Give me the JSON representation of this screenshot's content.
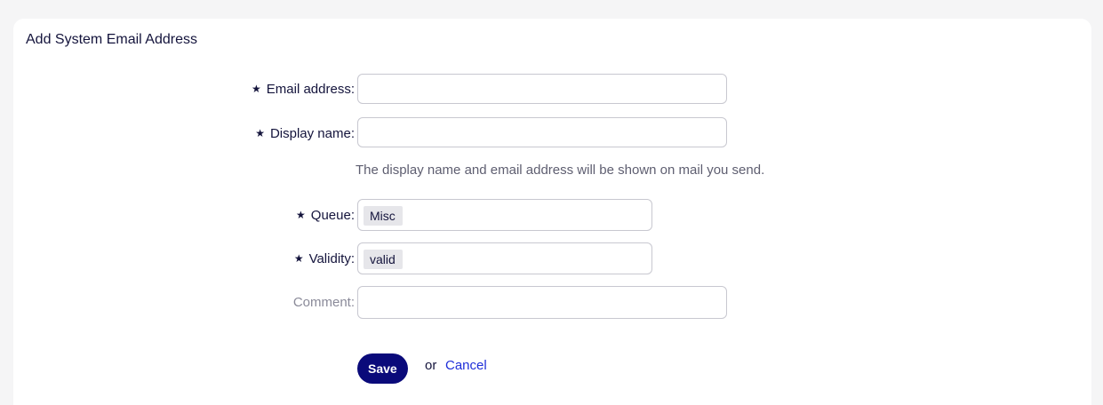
{
  "form": {
    "title": "Add System Email Address",
    "required_marker": "★",
    "email": {
      "label": "Email address:",
      "value": "",
      "placeholder": ""
    },
    "display_name": {
      "label": "Display name:",
      "value": "",
      "placeholder": ""
    },
    "hint": "The display name and email address will be shown on mail you send.",
    "queue": {
      "label": "Queue:",
      "selected": "Misc"
    },
    "validity": {
      "label": "Validity:",
      "selected": "valid"
    },
    "comment": {
      "label": "Comment:",
      "value": "",
      "placeholder": ""
    },
    "save_label": "Save",
    "or_text": "or",
    "cancel_label": "Cancel"
  }
}
